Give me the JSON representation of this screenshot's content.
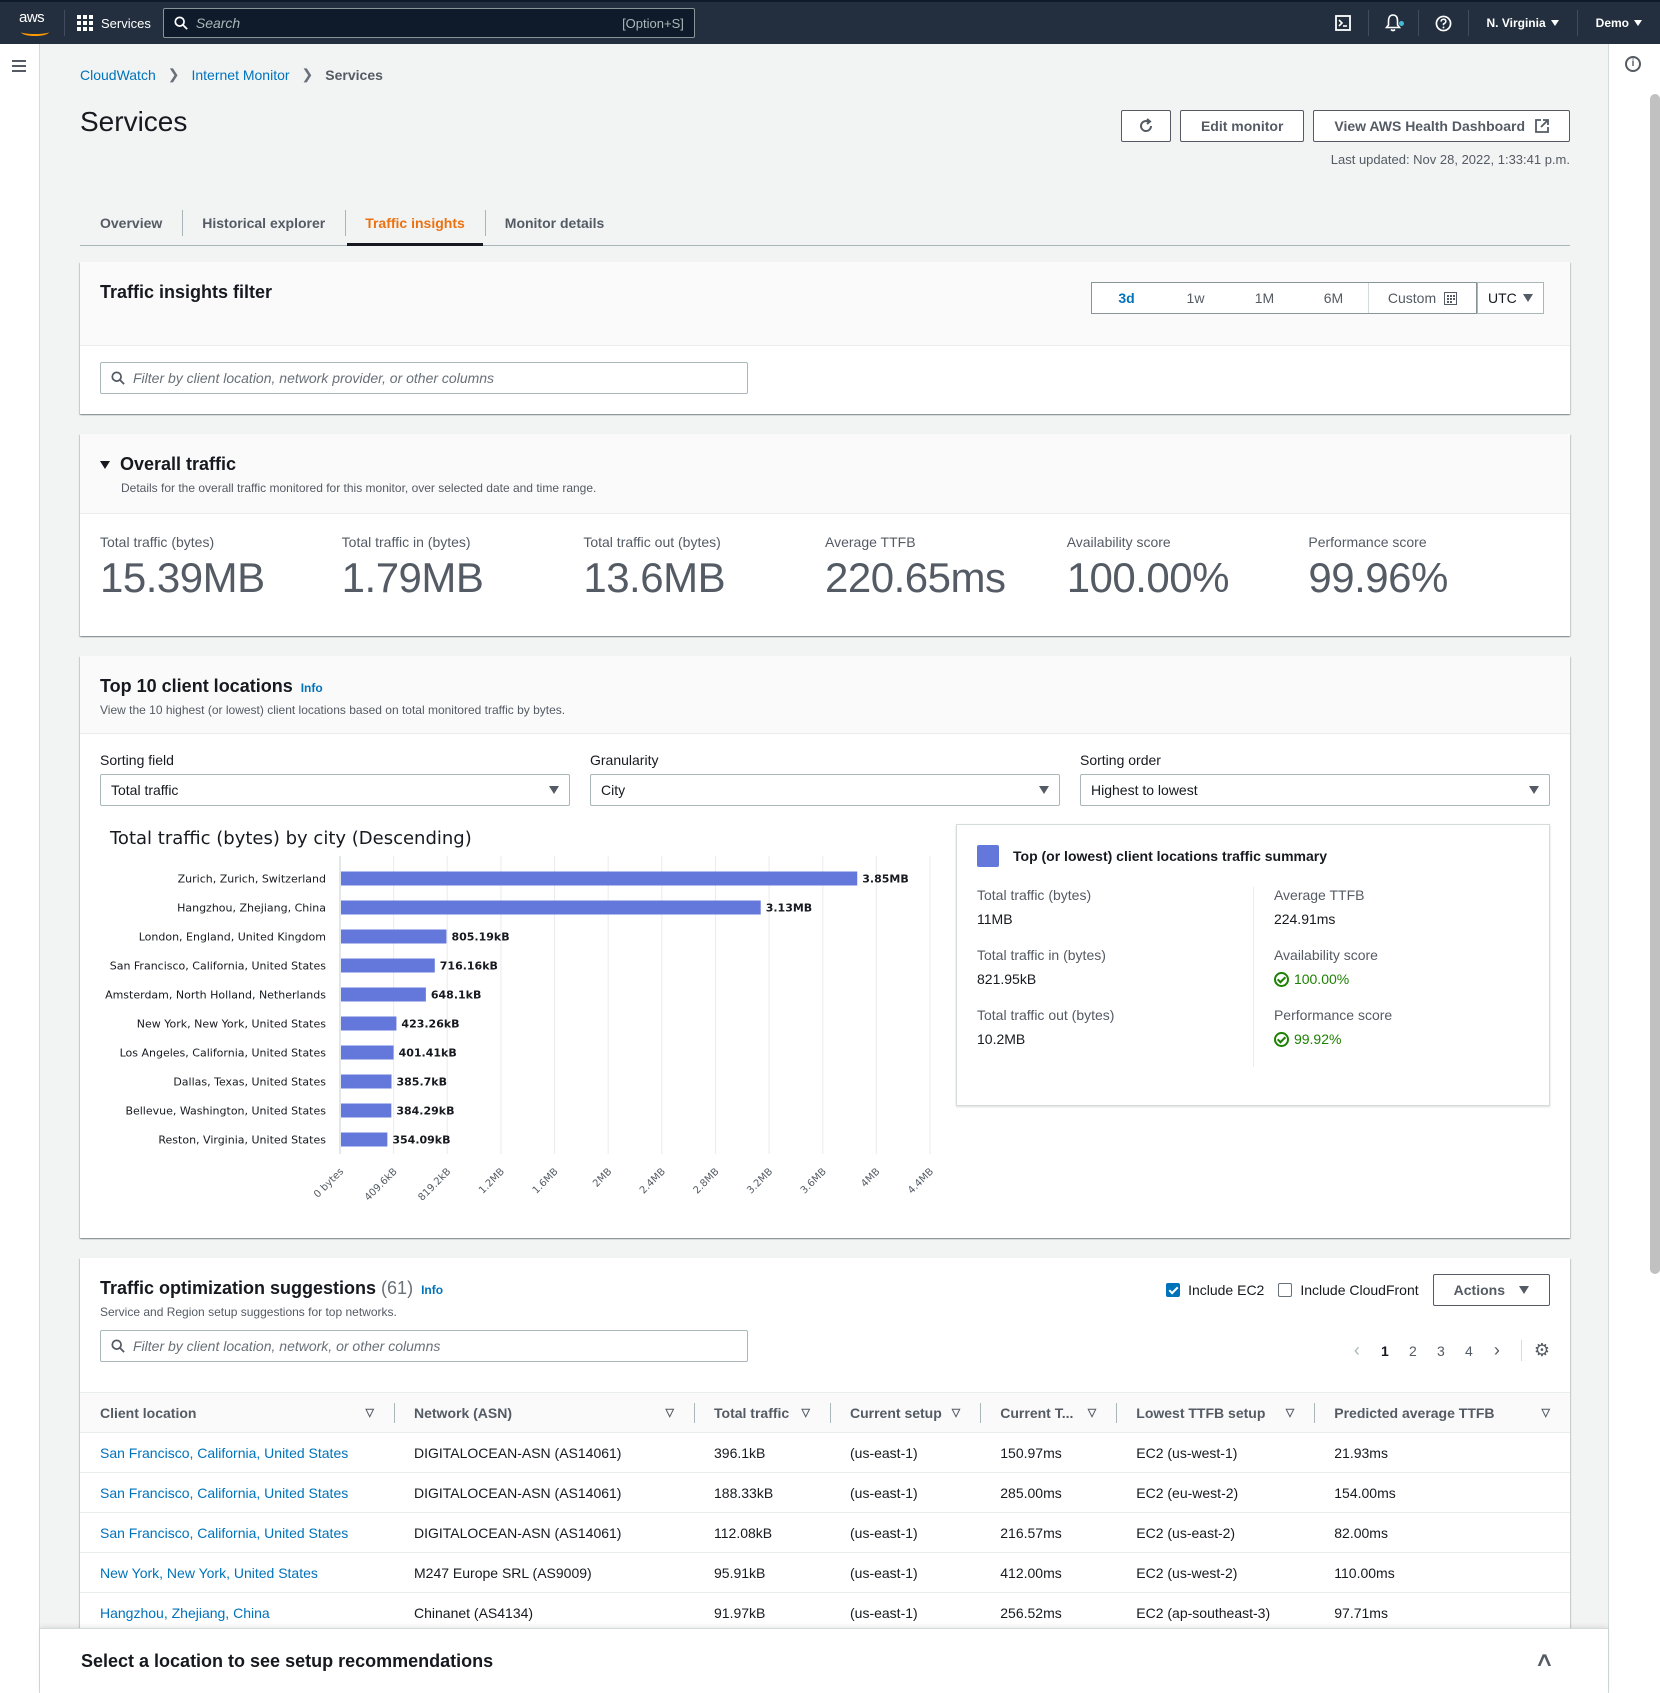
{
  "topnav": {
    "logo": "aws",
    "services_label": "Services",
    "search_placeholder": "Search",
    "search_shortcut": "[Option+S]",
    "region": "N. Virginia",
    "account": "Demo",
    "icons": [
      "cloudshell-icon",
      "bell-icon",
      "help-icon"
    ]
  },
  "breadcrumb": [
    {
      "label": "CloudWatch",
      "link": true
    },
    {
      "label": "Internet Monitor",
      "link": true
    },
    {
      "label": "Services",
      "link": false
    }
  ],
  "header": {
    "title": "Services",
    "refresh_icon": "refresh-icon",
    "edit_label": "Edit monitor",
    "health_label": "View AWS Health Dashboard",
    "last_updated": "Last updated: Nov 28, 2022, 1:33:41 p.m."
  },
  "tabs": [
    {
      "label": "Overview",
      "active": false
    },
    {
      "label": "Historical explorer",
      "active": false
    },
    {
      "label": "Traffic insights",
      "active": true
    },
    {
      "label": "Monitor details",
      "active": false
    }
  ],
  "filter_panel": {
    "title": "Traffic insights filter",
    "ranges": [
      "3d",
      "1w",
      "1M",
      "6M"
    ],
    "selected_range": "3d",
    "custom_label": "Custom",
    "timezone": "UTC",
    "search_placeholder": "Filter by client location, network provider, or other columns"
  },
  "overall": {
    "title": "Overall traffic",
    "description": "Details for the overall traffic monitored for this monitor, over selected date and time range.",
    "metrics": [
      {
        "label": "Total traffic (bytes)",
        "value": "15.39MB"
      },
      {
        "label": "Total traffic in (bytes)",
        "value": "1.79MB"
      },
      {
        "label": "Total traffic out (bytes)",
        "value": "13.6MB"
      },
      {
        "label": "Average TTFB",
        "value": "220.65ms"
      },
      {
        "label": "Availability score",
        "value": "100.00%"
      },
      {
        "label": "Performance score",
        "value": "99.96%"
      }
    ]
  },
  "top10": {
    "title": "Top 10 client locations",
    "info": "Info",
    "description": "View the 10 highest (or lowest) client locations based on total monitored traffic by bytes.",
    "selects": [
      {
        "label": "Sorting field",
        "value": "Total traffic"
      },
      {
        "label": "Granularity",
        "value": "City"
      },
      {
        "label": "Sorting order",
        "value": "Highest to lowest"
      }
    ],
    "summary": {
      "title": "Top (or lowest) client locations traffic summary",
      "left": [
        {
          "label": "Total traffic (bytes)",
          "value": "11MB"
        },
        {
          "label": "Total traffic in (bytes)",
          "value": "821.95kB"
        },
        {
          "label": "Total traffic out (bytes)",
          "value": "10.2MB"
        }
      ],
      "right": [
        {
          "label": "Average TTFB",
          "value": "224.91ms",
          "status": false
        },
        {
          "label": "Availability score",
          "value": "100.00%",
          "status": true
        },
        {
          "label": "Performance score",
          "value": "99.92%",
          "status": true
        }
      ]
    }
  },
  "chart_data": {
    "type": "bar",
    "orientation": "horizontal",
    "title": "Total traffic (bytes) by city (Descending)",
    "xlabel": "",
    "ylabel": "",
    "categories": [
      "Zurich, Zurich, Switzerland",
      "Hangzhou, Zhejiang, China",
      "London, England, United Kingdom",
      "San Francisco, California, United States",
      "Amsterdam, North Holland, Netherlands",
      "New York, New York, United States",
      "Los Angeles, California, United States",
      "Dallas, Texas, United States",
      "Bellevue, Washington, United States",
      "Reston, Virginia, United States"
    ],
    "values_bytes": [
      4037017.6,
      3282042.88,
      824514.56,
      733347.84,
      663654.4,
      433418.24,
      411043.84,
      394956.8,
      393512.96,
      362588.16
    ],
    "value_labels": [
      "3.85MB",
      "3.13MB",
      "805.19kB",
      "716.16kB",
      "648.1kB",
      "423.26kB",
      "401.41kB",
      "385.7kB",
      "384.29kB",
      "354.09kB"
    ],
    "x_ticks": [
      {
        "value": 0,
        "label": "0 bytes"
      },
      {
        "value": 419430.4,
        "label": "409.6kB"
      },
      {
        "value": 838860.8,
        "label": "819.2kB"
      },
      {
        "value": 1258291.2,
        "label": "1.2MB"
      },
      {
        "value": 1677721.6,
        "label": "1.6MB"
      },
      {
        "value": 2097152,
        "label": "2MB"
      },
      {
        "value": 2516582.4,
        "label": "2.4MB"
      },
      {
        "value": 2936012.8,
        "label": "2.8MB"
      },
      {
        "value": 3355443.2,
        "label": "3.2MB"
      },
      {
        "value": 3774873.6,
        "label": "3.6MB"
      },
      {
        "value": 4194304,
        "label": "4MB"
      },
      {
        "value": 4613734.4,
        "label": "4.4MB"
      }
    ],
    "xlim": [
      0,
      4613734.4
    ],
    "grid": true,
    "color": "#6478dc"
  },
  "suggestions": {
    "title": "Traffic optimization suggestions",
    "count": "(61)",
    "info": "Info",
    "description": "Service and Region setup suggestions for top networks.",
    "include_ec2": {
      "label": "Include EC2",
      "checked": true
    },
    "include_cloudfront": {
      "label": "Include CloudFront",
      "checked": false
    },
    "actions_label": "Actions",
    "search_placeholder": "Filter by client location, network, or other columns",
    "pages": [
      "1",
      "2",
      "3",
      "4"
    ],
    "current_page": "1",
    "columns": [
      "Client location",
      "Network (ASN)",
      "Total traffic",
      "Current setup",
      "Current T...",
      "Lowest TTFB setup",
      "Predicted average TTFB"
    ],
    "rows": [
      [
        "San Francisco, California, United States",
        "DIGITALOCEAN-ASN (AS14061)",
        "396.1kB",
        "(us-east-1)",
        "150.97ms",
        "EC2 (us-west-1)",
        "21.93ms"
      ],
      [
        "San Francisco, California, United States",
        "DIGITALOCEAN-ASN (AS14061)",
        "188.33kB",
        "(us-east-1)",
        "285.00ms",
        "EC2 (eu-west-2)",
        "154.00ms"
      ],
      [
        "San Francisco, California, United States",
        "DIGITALOCEAN-ASN (AS14061)",
        "112.08kB",
        "(us-east-1)",
        "216.57ms",
        "EC2 (us-east-2)",
        "82.00ms"
      ],
      [
        "New York, New York, United States",
        "M247 Europe SRL (AS9009)",
        "95.91kB",
        "(us-east-1)",
        "412.00ms",
        "EC2 (us-west-2)",
        "110.00ms"
      ],
      [
        "Hangzhou, Zhejiang, China",
        "Chinanet (AS4134)",
        "91.97kB",
        "(us-east-1)",
        "256.52ms",
        "EC2 (ap-southeast-3)",
        "97.71ms"
      ]
    ]
  },
  "drawer": {
    "title": "Select a location to see setup recommendations"
  }
}
